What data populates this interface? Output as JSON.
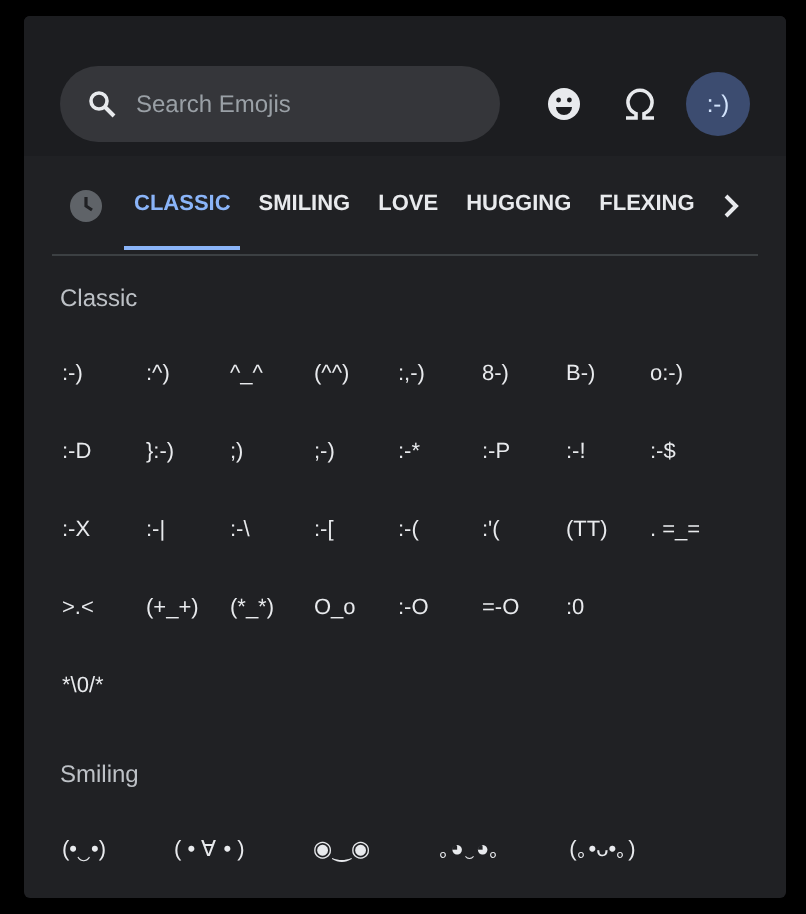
{
  "search": {
    "placeholder": "Search Emojis"
  },
  "modes": [
    {
      "kind": "emoji",
      "selected": false
    },
    {
      "kind": "symbols",
      "selected": false
    },
    {
      "kind": "emoticon",
      "label": ":-)",
      "selected": true
    }
  ],
  "tabs": [
    {
      "kind": "recent",
      "selected": false
    },
    {
      "label": "CLASSIC",
      "selected": true
    },
    {
      "label": "SMILING",
      "selected": false
    },
    {
      "label": "LOVE",
      "selected": false
    },
    {
      "label": "HUGGING",
      "selected": false
    },
    {
      "label": "FLEXING",
      "selected": false
    },
    {
      "kind": "next"
    }
  ],
  "sections": [
    {
      "title": "Classic",
      "rows": [
        [
          ":-)",
          ":^)",
          "^_^",
          "(^^)",
          ":,-)",
          "8-)",
          "B-)",
          "o:-)"
        ],
        [
          ":-D",
          "}:-)",
          ";)",
          ";-)",
          ":-*",
          ":-P",
          ":-!",
          ":-$"
        ],
        [
          ":-X",
          ":-|",
          ":-\\",
          ":-[",
          ":-(",
          ":'(",
          "(TT)",
          ". =_="
        ],
        [
          ">.<",
          "(+_+)",
          "(*_*)",
          "O_o",
          ":-O",
          "=-O",
          ":0"
        ],
        [
          "*\\0/*"
        ]
      ]
    },
    {
      "title": "Smiling",
      "rows": [
        [
          "(•‿•)",
          "( • ∀ • )",
          "◉‿◉",
          "｡◕‿◕｡",
          "(｡•ᴗ•｡)"
        ]
      ]
    }
  ]
}
